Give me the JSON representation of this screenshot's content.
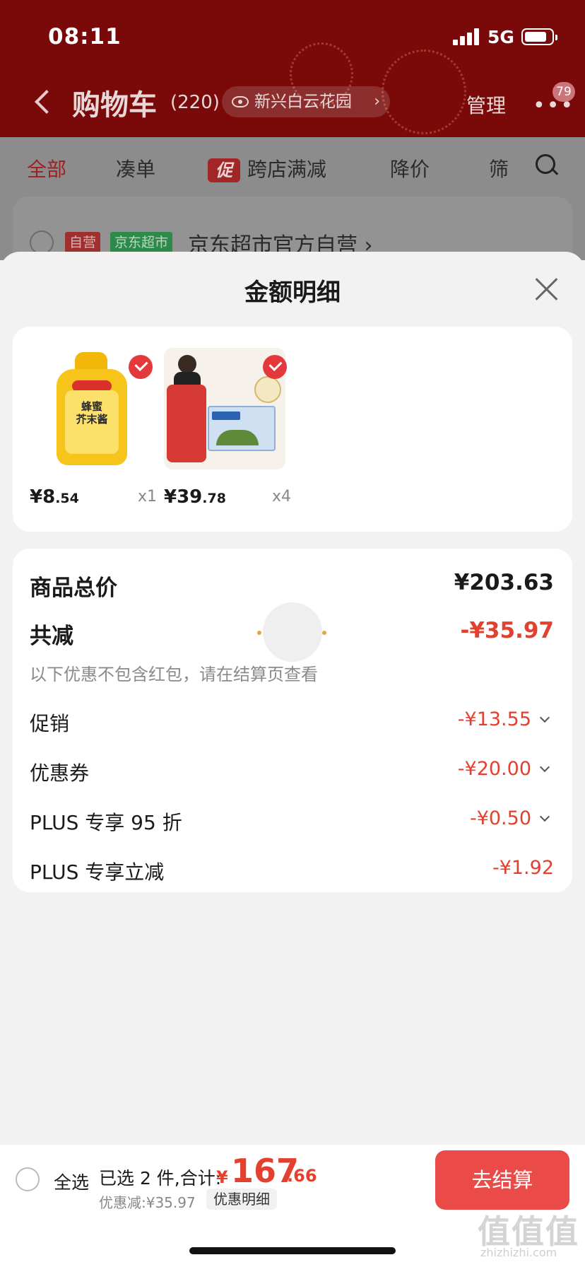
{
  "status_bar": {
    "time": "08:11",
    "network": "5G"
  },
  "nav": {
    "title": "购物车",
    "count": "(220)",
    "location": "新兴白云花园",
    "manage_label": "管理",
    "more_badge": "79"
  },
  "tabs": [
    {
      "label": "全部"
    },
    {
      "label": "凑单"
    },
    {
      "label": "跨店满减",
      "tag": "促"
    },
    {
      "label": "降价"
    },
    {
      "label": "筛"
    }
  ],
  "store": {
    "tag_self": "自营",
    "tag_market": "京东超市",
    "name": "京东超市官方自营 ›"
  },
  "sheet": {
    "title": "金额明细",
    "products": [
      {
        "name_text": "蜂蜜\n芥末酱",
        "price_main": "¥8",
        "price_dec": ".54",
        "qty": "x1"
      },
      {
        "name_text": "",
        "price_main": "¥39",
        "price_dec": ".78",
        "qty": "x4"
      }
    ],
    "summary": {
      "total_label": "商品总价",
      "total_value": "¥203.63",
      "reduce_label": "共减",
      "reduce_value": "-¥35.97",
      "note": "以下优惠不包含红包，请在结算页查看",
      "rows": [
        {
          "label": "促销",
          "value": "-¥13.55",
          "expandable": true
        },
        {
          "label": "优惠券",
          "value": "-¥20.00",
          "expandable": true
        },
        {
          "label": "PLUS 专享 95 折",
          "value": "-¥0.50",
          "expandable": true
        },
        {
          "label": "PLUS 专享立减",
          "value": "-¥1.92",
          "expandable": false
        }
      ]
    }
  },
  "bottom_bar": {
    "select_all": "全选",
    "selected_text": "已选 2 件,合计:",
    "currency": "¥",
    "total_int": "167",
    "total_dec": ".66",
    "discount_text": "优惠减:¥35.97",
    "detail_link": "优惠明细",
    "checkout_label": "去结算"
  },
  "watermark": {
    "text": "值值值",
    "url": "zhizhizhi.com"
  },
  "colors": {
    "accent_red": "#e2412f",
    "header_dark_red": "#7a0a0a",
    "checkout": "#ea4b48"
  }
}
